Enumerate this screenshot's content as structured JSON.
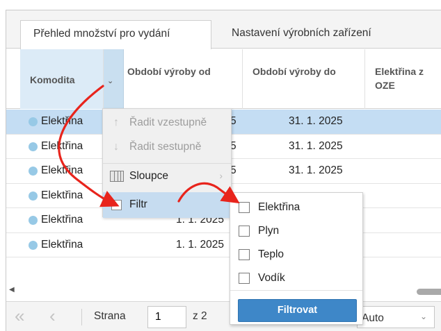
{
  "tabs": [
    "Přehled množství pro vydání",
    "Nastavení výrobních zařízení"
  ],
  "columns": {
    "komodita": "Komodita",
    "od": "Období výroby od",
    "do": "Období výroby do",
    "oze": "Elektřina z OZE"
  },
  "rows": [
    {
      "komodita": "Elektřina",
      "od": "5",
      "do": "31. 1. 2025",
      "selected": true
    },
    {
      "komodita": "Elektřina",
      "od": "5",
      "do": "31. 1. 2025"
    },
    {
      "komodita": "Elektřina",
      "od": "5",
      "do": "31. 1. 2025"
    },
    {
      "komodita": "Elektřina",
      "od": "",
      "do": ""
    },
    {
      "komodita": "Elektřina",
      "od": "1. 1. 2025",
      "do": ""
    },
    {
      "komodita": "Elektřina",
      "od": "1. 1. 2025",
      "do": ""
    }
  ],
  "menu": {
    "sort_asc": "Řadit vzestupně",
    "sort_desc": "Řadit sestupně",
    "columns": "Sloupce",
    "filter": "Filtr"
  },
  "filter_submenu": {
    "options": [
      "Elektřina",
      "Plyn",
      "Teplo",
      "Vodík"
    ],
    "apply_label": "Filtrovat"
  },
  "pager": {
    "page_label": "Strana",
    "page_value": "1",
    "of_label": "z 2",
    "page_size": "Auto"
  },
  "colors": {
    "accent": "#3e87c8",
    "annotation_arrow": "#e8241c",
    "selected_row": "#c4ddf3"
  }
}
